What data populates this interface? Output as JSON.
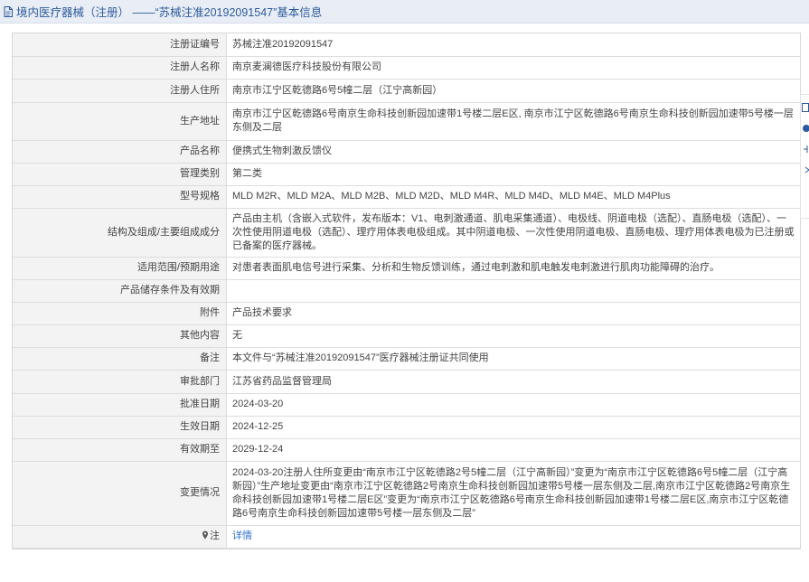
{
  "header": {
    "title": "境内医疗器械（注册） ——“苏械注准20192091547”基本信息",
    "icon": "document-icon"
  },
  "rows": [
    {
      "label": "注册证编号",
      "value": "苏械注准20192091547"
    },
    {
      "label": "注册人名称",
      "value": "南京麦澜德医疗科技股份有限公司"
    },
    {
      "label": "注册人住所",
      "value": "南京市江宁区乾德路6号5幢二层（江宁高新园）"
    },
    {
      "label": "生产地址",
      "value": "南京市江宁区乾德路6号南京生命科技创新园加速带1号楼二层E区, 南京市江宁区乾德路6号南京生命科技创新园加速带5号楼一层东侧及二层"
    },
    {
      "label": "产品名称",
      "value": "便携式生物刺激反馈仪"
    },
    {
      "label": "管理类别",
      "value": "第二类"
    },
    {
      "label": "型号规格",
      "value": "MLD M2R、MLD M2A、MLD M2B、MLD M2D、MLD M4R、MLD M4D、MLD M4E、MLD M4Plus"
    },
    {
      "label": "结构及组成/主要组成成分",
      "value": "产品由主机（含嵌入式软件，发布版本：V1、电刺激通道、肌电采集通道）、电极线、阴道电极（选配）、直肠电极（选配）、一次性使用阴道电极（选配）、理疗用体表电极组成。其中阴道电极、一次性使用阴道电极、直肠电极、理疗用体表电极为已注册或已备案的医疗器械。"
    },
    {
      "label": "适用范围/预期用途",
      "value": "对患者表面肌电信号进行采集、分析和生物反馈训练，通过电刺激和肌电触发电刺激进行肌肉功能障碍的治疗。"
    },
    {
      "label": "产品储存条件及有效期",
      "value": ""
    },
    {
      "label": "附件",
      "value": "产品技术要求"
    },
    {
      "label": "其他内容",
      "value": "无"
    },
    {
      "label": "备注",
      "value": "本文件与“苏械注准20192091547”医疗器械注册证共同使用"
    },
    {
      "label": "审批部门",
      "value": "江苏省药品监督管理局"
    },
    {
      "label": "批准日期",
      "value": "2024-03-20"
    },
    {
      "label": "生效日期",
      "value": "2024-12-25"
    },
    {
      "label": "有效期至",
      "value": "2029-12-24"
    },
    {
      "label": "变更情况",
      "value": "2024-03-20注册人住所变更由“南京市江宁区乾德路2号5幢二层（江宁高新园）”变更为“南京市江宁区乾德路6号5幢二层（江宁高新园）”生产地址变更由“南京市江宁区乾德路2号南京生命科技创新园加速带5号楼一层东侧及二层,南京市江宁区乾德路2号南京生命科技创新园加速带1号楼二层E区”变更为“南京市江宁区乾德路6号南京生命科技创新园加速带1号楼二层E区,南京市江宁区乾德路6号南京生命科技创新园加速带5号楼一层东侧及二层”"
    }
  ],
  "note": {
    "label": "注",
    "link": "详情",
    "icon": "pin-icon"
  },
  "side_tools": [
    "document-icon",
    "circle-icon",
    "share-icon",
    "close-icon"
  ],
  "colors": {
    "accent": "#2c5a9c",
    "link": "#2f6fd3",
    "label_bg": "#f3f3f3"
  }
}
